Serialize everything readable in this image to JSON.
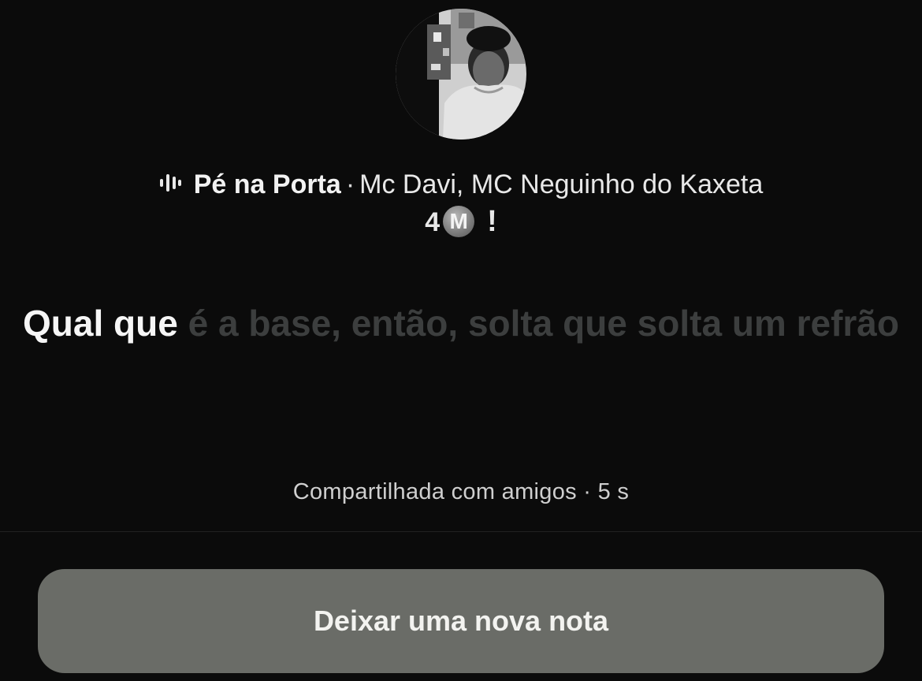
{
  "note": {
    "song_title": "Pé na Porta",
    "separator": "·",
    "artists": "Mc Davi, MC Neguinho do Kaxeta",
    "stats_count": "4",
    "stats_badge": "M",
    "stats_exclaim": "!",
    "lyrics_sung": "Qual que",
    "lyrics_unsung": "é a base, então, solta que solta um refrão",
    "shared_text": "Compartilhada com amigos · 5 s"
  },
  "actions": {
    "leave_note_label": "Deixar uma nova nota"
  },
  "icons": {
    "music_wave": "audio-wave-icon",
    "avatar": "profile-photo"
  },
  "colors": {
    "background": "#0b0b0b",
    "lyrics_active": "#f6f6f6",
    "lyrics_inactive": "#3c3e3e",
    "button_bg": "#6a6c67"
  }
}
